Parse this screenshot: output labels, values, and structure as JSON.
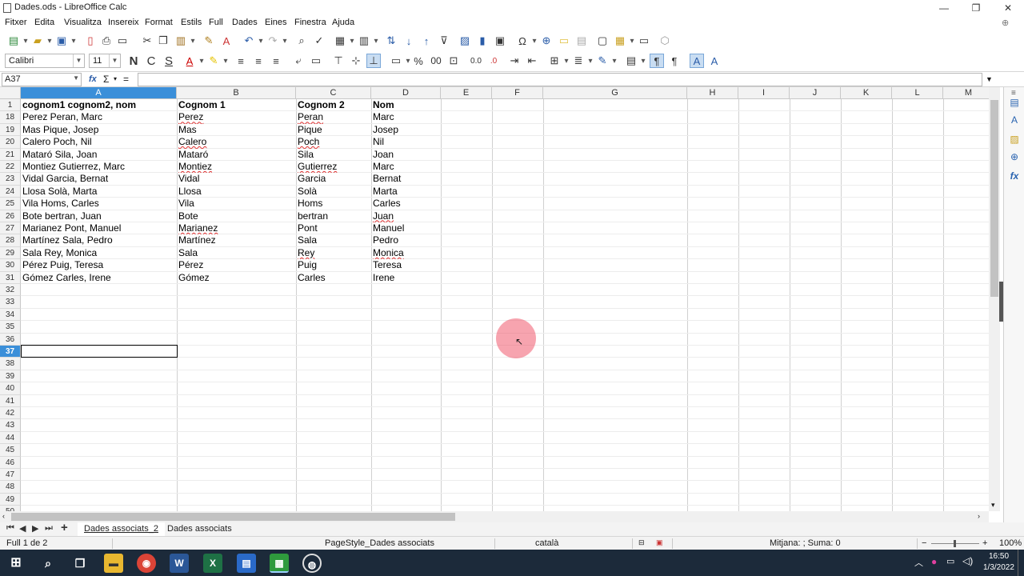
{
  "window": {
    "title": "Dades.ods - LibreOffice Calc",
    "minimize": "—",
    "restore": "❐",
    "close": "✕"
  },
  "menu": [
    "Fitxer",
    "Edita",
    "Visualitza",
    "Insereix",
    "Format",
    "Estils",
    "Full",
    "Dades",
    "Eines",
    "Finestra",
    "Ajuda"
  ],
  "format": {
    "font_name": "Calibri",
    "font_size": "11",
    "bold": "N",
    "italic": "C",
    "underline": "S",
    "percent": "%",
    "decimal": "00",
    "decimal_add": "0.0",
    "decimal_del": ".0"
  },
  "formula": {
    "cell_ref": "A37",
    "fx": "fx",
    "sum": "Σ",
    "eq": "=",
    "content": ""
  },
  "columns": [
    "A",
    "B",
    "C",
    "D",
    "E",
    "F",
    "G",
    "H",
    "I",
    "J",
    "K",
    "L",
    "M"
  ],
  "rows": [
    "1",
    "18",
    "19",
    "20",
    "21",
    "22",
    "23",
    "24",
    "25",
    "26",
    "27",
    "28",
    "29",
    "30",
    "31",
    "32",
    "33",
    "34",
    "35",
    "36",
    "37",
    "38",
    "39",
    "40",
    "41",
    "42",
    "43",
    "44",
    "45",
    "46",
    "47",
    "48",
    "49",
    "50"
  ],
  "selected_row": "37",
  "selected_col": "A",
  "table": [
    [
      "cognom1 cognom2, nom",
      "Cognom 1",
      "Cognom 2",
      "Nom"
    ],
    [
      "Perez Peran, Marc",
      "Perez",
      "Peran",
      "Marc"
    ],
    [
      "Mas Pique, Josep",
      "Mas",
      "Pique",
      "Josep"
    ],
    [
      "Calero Poch, Nil",
      "Calero",
      "Poch",
      "Nil"
    ],
    [
      "Mataró Sila, Joan",
      "Mataró",
      "Sila",
      "Joan"
    ],
    [
      "Montiez Gutierrez, Marc",
      "Montiez",
      "Gutierrez",
      "Marc"
    ],
    [
      "Vidal Garcia, Bernat",
      "Vidal",
      "Garcia",
      "Bernat"
    ],
    [
      "Llosa Solà, Marta",
      "Llosa",
      "Solà",
      "Marta"
    ],
    [
      "Vila Homs, Carles",
      "Vila",
      "Homs",
      "Carles"
    ],
    [
      "Bote bertran, Juan",
      "Bote",
      "bertran",
      "Juan"
    ],
    [
      "Marianez Pont, Manuel",
      "Marianez",
      "Pont",
      "Manuel"
    ],
    [
      "Martínez Sala, Pedro",
      "Martínez",
      "Sala",
      "Pedro"
    ],
    [
      "Sala Rey, Monica",
      "Sala",
      "Rey",
      "Monica"
    ],
    [
      "Pérez Puig, Teresa",
      "Pérez",
      "Puig",
      "Teresa"
    ],
    [
      "Gómez Carles, Irene",
      "Gómez",
      "Carles",
      "Irene"
    ]
  ],
  "sheets": [
    "Dades associats_2",
    "Dades associats"
  ],
  "active_sheet": "Dades associats_2",
  "status": {
    "sheet_info": "Full 1 de 2",
    "page_style": "PageStyle_Dades associats",
    "language": "català",
    "summary": "Mitjana: ; Suma: 0",
    "zoom": "100%"
  },
  "taskbar": {
    "time": "16:50",
    "date": "1/3/2022"
  },
  "colors": {
    "accent": "#3b8fd9",
    "taskbar": "#1c2a3a",
    "cursor_highlight": "#f05a6e"
  }
}
